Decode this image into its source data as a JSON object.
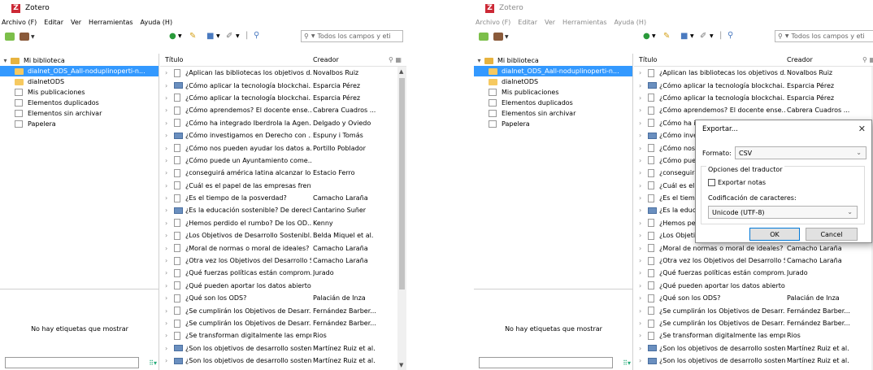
{
  "app": {
    "title": "Zotero",
    "menu": [
      "Archivo (F)",
      "Editar",
      "Ver",
      "Herramientas",
      "Ayuda (H)"
    ]
  },
  "toolbar": {
    "search_placeholder": "Todos los campos y eti"
  },
  "sidebar": {
    "items": [
      {
        "label": "Mi biblioteca",
        "icon": "library-icon"
      },
      {
        "label": "dialnet_ODS_Aall-noduplinoperti-n...",
        "icon": "folder-icon"
      },
      {
        "label": "dialnetODS",
        "icon": "folder-icon"
      },
      {
        "label": "Mis publicaciones",
        "icon": "publications-icon"
      },
      {
        "label": "Elementos duplicados",
        "icon": "duplicates-icon"
      },
      {
        "label": "Elementos sin archivar",
        "icon": "unfiled-icon"
      },
      {
        "label": "Papelera",
        "icon": "trash-icon"
      }
    ],
    "tags_message": "No hay etiquetas que mostrar"
  },
  "items": {
    "columns": {
      "title": "Título",
      "creator": "Creador"
    },
    "rows": [
      {
        "title": "¿Aplican las bibliotecas los objetivos d...",
        "creator": "Novalbos Ruiz",
        "type": "doc"
      },
      {
        "title": "¿Cómo aplicar la tecnología blockchai...",
        "creator": "Esparcia Pérez",
        "type": "book"
      },
      {
        "title": "¿Cómo aplicar la tecnología blockchai...",
        "creator": "Esparcia Pérez",
        "type": "doc"
      },
      {
        "title": "¿Cómo aprendemos? El docente ense...",
        "creator": "Cabrera Cuadros ...",
        "type": "doc"
      },
      {
        "title": "¿Cómo ha integrado Iberdrola la Agen...",
        "creator": "Delgado y Oviedo",
        "type": "doc"
      },
      {
        "title": "¿Cómo investigamos en Derecho con ...",
        "creator": "Espuny i Tomás",
        "type": "book"
      },
      {
        "title": "¿Cómo nos pueden ayudar los datos a...",
        "creator": "Portillo Poblador",
        "type": "doc"
      },
      {
        "title": "¿Cómo puede un Ayuntamiento come...",
        "creator": "",
        "type": "doc"
      },
      {
        "title": "¿conseguirá américa latina alcanzar lo...",
        "creator": "Estacio Ferro",
        "type": "doc"
      },
      {
        "title": "¿Cuál es el papel de las empresas frent...",
        "creator": "",
        "type": "doc"
      },
      {
        "title": "¿Es el tiempo de la posverdad?",
        "creator": "Camacho Laraña",
        "type": "doc"
      },
      {
        "title": "¿Es la educación sostenible? De derech...",
        "creator": "Cantarino Suñer",
        "type": "book"
      },
      {
        "title": "¿Hemos perdido el rumbo? De los OD...",
        "creator": "Kenny",
        "type": "doc"
      },
      {
        "title": "¿Los Objetivos de Desarrollo Sostenibl...",
        "creator": "Belda Miquel et al.",
        "type": "doc"
      },
      {
        "title": "¿Moral de normas o moral de ideales?",
        "creator": "Camacho Laraña",
        "type": "doc"
      },
      {
        "title": "¿Otra vez los Objetivos del Desarrollo S...",
        "creator": "Camacho Laraña",
        "type": "doc"
      },
      {
        "title": "¿Qué fuerzas políticas están comprom...",
        "creator": "Jurado",
        "type": "doc"
      },
      {
        "title": "¿Qué pueden aportar los datos abierto...",
        "creator": "",
        "type": "doc"
      },
      {
        "title": "¿Qué son los ODS?",
        "creator": "Palacián de Inza",
        "type": "doc"
      },
      {
        "title": "¿Se cumplirán los Objetivos de Desarr...",
        "creator": "Fernández Barber...",
        "type": "doc"
      },
      {
        "title": "¿Se cumplirán los Objetivos de Desarr...",
        "creator": "Fernández Barber...",
        "type": "doc"
      },
      {
        "title": "¿Se transforman digitalmente las empr...",
        "creator": "Rios",
        "type": "doc"
      },
      {
        "title": "¿Son los objetivos de desarrollo sosten...",
        "creator": "Martínez Ruiz et al.",
        "type": "book"
      },
      {
        "title": "¿Son los objetivos de desarrollo sosten...",
        "creator": "Martínez Ruiz et al.",
        "type": "book"
      }
    ]
  },
  "dialog": {
    "title": "Exportar...",
    "format_label": "Formato:",
    "format_value": "CSV",
    "options_label": "Opciones del traductor",
    "export_notes_label": "Exportar notas",
    "export_notes_checked": false,
    "encoding_label": "Codificación de caracteres:",
    "encoding_value": "Unicode (UTF-8)",
    "ok_label": "OK",
    "cancel_label": "Cancel"
  },
  "colors": {
    "selection": "#3399ff",
    "brand": "#cc2936"
  }
}
